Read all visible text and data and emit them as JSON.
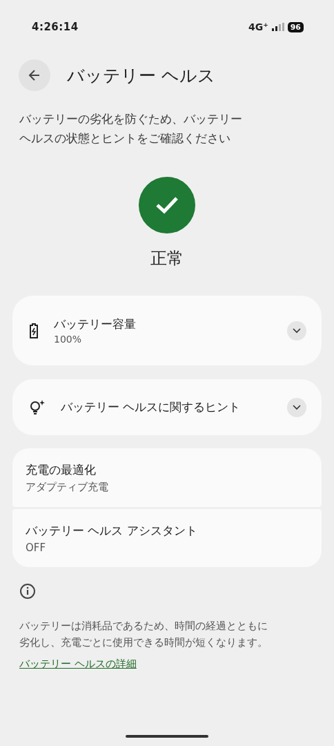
{
  "status_bar": {
    "time": "4:26:14",
    "network": "4G",
    "network_plus": "+",
    "battery": "96"
  },
  "header": {
    "title": "バッテリー ヘルス"
  },
  "description": "バッテリーの劣化を防ぐため、バッテリーヘルスの状態とヒントをご確認ください",
  "status": {
    "label": "正常",
    "ok": true
  },
  "expandable_cards": [
    {
      "kind": "battery",
      "title": "バッテリー容量",
      "subtitle": "100%",
      "expanded": false
    },
    {
      "kind": "tips",
      "title": "バッテリー ヘルスに関するヒント",
      "expanded": false
    }
  ],
  "settings": [
    {
      "title": "充電の最適化",
      "subtitle": "アダプティブ充電"
    },
    {
      "title": "バッテリー ヘルス アシスタント",
      "subtitle": "OFF"
    }
  ],
  "footer": {
    "text": "バッテリーは消耗品であるため、時間の経過とともに劣化し、充電ごとに使用できる時間が短くなります。",
    "link": "バッテリー ヘルスの詳細"
  }
}
